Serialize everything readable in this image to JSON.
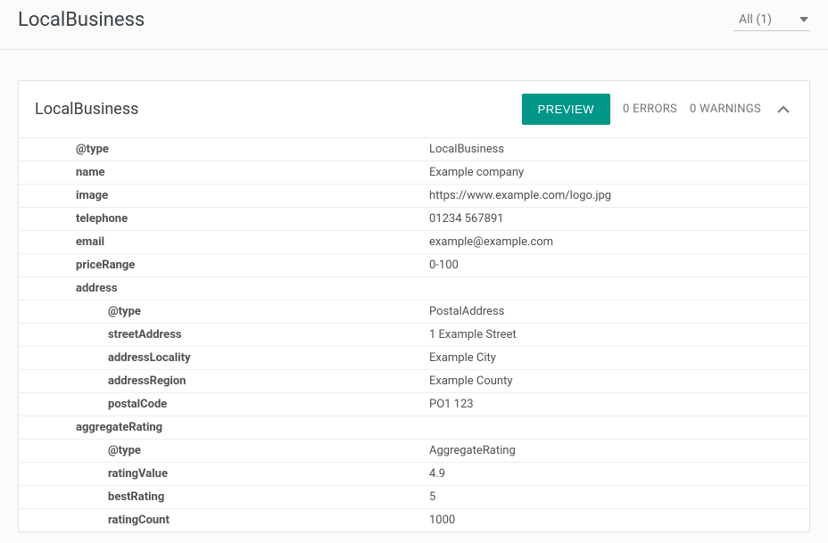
{
  "header": {
    "title": "LocalBusiness",
    "filter_label": "All (1)"
  },
  "card": {
    "title": "LocalBusiness",
    "preview_label": "PREVIEW",
    "errors_label": "0 ERRORS",
    "warnings_label": "0 WARNINGS"
  },
  "properties": {
    "type_key": "@type",
    "type_val": "LocalBusiness",
    "name_key": "name",
    "name_val": "Example company",
    "image_key": "image",
    "image_val": "https://www.example.com/logo.jpg",
    "telephone_key": "telephone",
    "telephone_val": "01234 567891",
    "email_key": "email",
    "email_val": "example@example.com",
    "priceRange_key": "priceRange",
    "priceRange_val": "0-100",
    "address_key": "address",
    "address_type_key": "@type",
    "address_type_val": "PostalAddress",
    "streetAddress_key": "streetAddress",
    "streetAddress_val": "1 Example Street",
    "addressLocality_key": "addressLocality",
    "addressLocality_val": "Example City",
    "addressRegion_key": "addressRegion",
    "addressRegion_val": "Example County",
    "postalCode_key": "postalCode",
    "postalCode_val": "PO1 123",
    "aggregateRating_key": "aggregateRating",
    "aggregateRating_type_key": "@type",
    "aggregateRating_type_val": "AggregateRating",
    "ratingValue_key": "ratingValue",
    "ratingValue_val": "4.9",
    "bestRating_key": "bestRating",
    "bestRating_val": "5",
    "ratingCount_key": "ratingCount",
    "ratingCount_val": "1000"
  }
}
